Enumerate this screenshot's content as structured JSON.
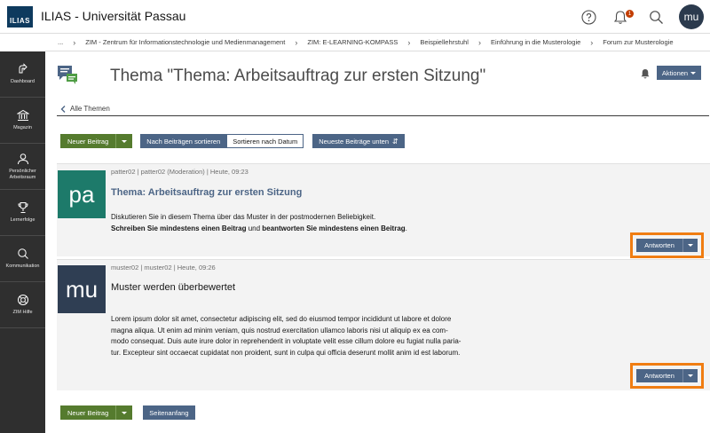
{
  "header": {
    "logo_text": "ILIAS",
    "app_title": "ILIAS - Universität Passau",
    "notification_count": "1",
    "avatar_initials": "mu"
  },
  "breadcrumb": {
    "items": [
      "...",
      "ZIM - Zentrum für Informationstechnologie und Medienmanagement",
      "ZIM: E-LEARNING-KOMPASS",
      "Beispiellehrstuhl",
      "Einführung in die Musterologie",
      "Forum zur Musterologie"
    ]
  },
  "sidebar": {
    "items": [
      {
        "label": "Dashboard",
        "icon": "dashboard-icon"
      },
      {
        "label": "Magazin",
        "icon": "magazine-icon"
      },
      {
        "label": "Persönlicher Arbeitsraum",
        "icon": "person-icon"
      },
      {
        "label": "Lernerfolge",
        "icon": "trophy-icon"
      },
      {
        "label": "Kommunikation",
        "icon": "chat-icon"
      },
      {
        "label": "ZIM Hilfe",
        "icon": "lifebuoy-icon"
      }
    ]
  },
  "page": {
    "title": "Thema \"Thema: Arbeitsauftrag zur ersten Sitzung\"",
    "actions_label": "Aktionen",
    "back_link": "Alle Themen"
  },
  "toolbar": {
    "new_post": "Neuer Beitrag",
    "sort_by_posts": "Nach Beiträgen sortieren",
    "sort_by_date": "Sortieren nach Datum",
    "newest_bottom": "Neueste Beiträge unten",
    "page_top": "Seitenanfang"
  },
  "posts": [
    {
      "avatar": "pa",
      "meta": "patter02 | patter02 (Moderation) | Heute, 09:23",
      "subject": "Thema: Arbeitsauftrag zur ersten Sitzung",
      "body_line1": "Diskutieren Sie in diesem Thema über das Muster in der postmodernen Beliebigkeit.",
      "body_bold1": "Schreiben Sie mindestens einen Beitrag",
      "body_mid": " und ",
      "body_bold2": "beantworten Sie mindestens einen Beitrag",
      "body_end": ".",
      "reply_label": "Antworten"
    },
    {
      "avatar": "mu",
      "meta": "muster02 | muster02 | Heute, 09:26",
      "subject": "Muster werden überbewertet",
      "body_lines": [
        "Lorem ipsum dolor sit amet, consectetur adipiscing elit, sed do eiusmod tempor incididunt ut labore et dolore",
        "magna aliqua. Ut enim ad minim veniam, quis nostrud exercitation ullamco laboris nisi ut aliquip ex ea com-",
        "modo consequat. Duis aute irure dolor in reprehenderit in voluptate velit esse cillum dolore eu fugiat nulla paria-",
        "tur. Excepteur sint occaecat cupidatat non proident, sunt in culpa qui officia deserunt mollit anim id est laborum."
      ],
      "reply_label": "Antworten"
    }
  ],
  "colors": {
    "primary": "#4c6586",
    "success": "#557b2e",
    "highlight": "#f07d12",
    "sidebar": "#2f2f2f"
  }
}
